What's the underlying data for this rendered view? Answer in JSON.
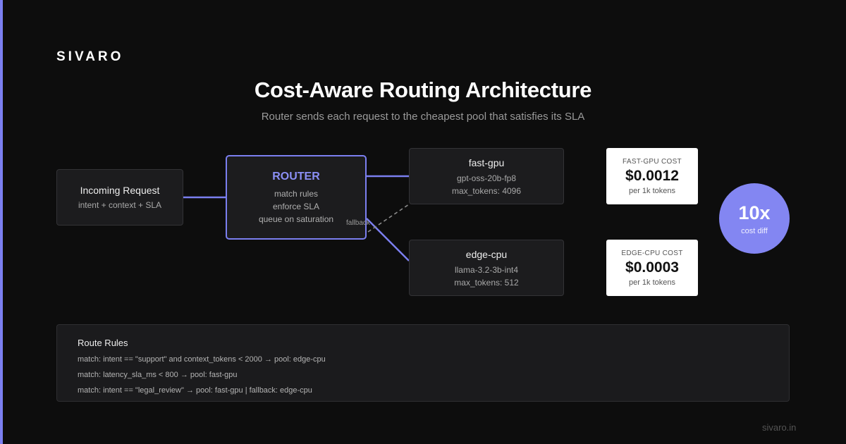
{
  "brand": "SIVARO",
  "title": "Cost-Aware Routing Architecture",
  "subtitle": "Router sends each request to the cheapest pool that satisfies its SLA",
  "nodes": {
    "request": {
      "title": "Incoming Request",
      "line1": "intent + context + SLA"
    },
    "router": {
      "title": "ROUTER",
      "lines": [
        "match rules",
        "enforce SLA",
        "queue on saturation"
      ]
    },
    "fast_gpu": {
      "title": "fast-gpu",
      "line1": "gpt-oss-20b-fp8",
      "line2": "max_tokens: 4096"
    },
    "edge_cpu": {
      "title": "edge-cpu",
      "line1": "llama-3.2-3b-int4",
      "line2": "max_tokens: 512"
    }
  },
  "edges": {
    "fallback_label": "fallback"
  },
  "costs": {
    "fast_gpu": {
      "label": "FAST-GPU COST",
      "value": "$0.0012",
      "unit": "per 1k tokens"
    },
    "edge_cpu": {
      "label": "EDGE-CPU COST",
      "value": "$0.0003",
      "unit": "per 1k tokens"
    }
  },
  "diff": {
    "value": "10x",
    "label": "cost diff"
  },
  "rules": {
    "heading": "Route Rules",
    "items": [
      "match: intent == \"support\" and context_tokens < 2000 → pool: edge-cpu",
      "match: latency_sla_ms < 800 → pool: fast-gpu",
      "match: intent == \"legal_review\" → pool: fast-gpu | fallback: edge-cpu"
    ]
  },
  "footer": "sivaro.in",
  "colors": {
    "accent": "#7b7ff0",
    "background": "#0d0d0d",
    "panel": "#1c1c1e"
  }
}
